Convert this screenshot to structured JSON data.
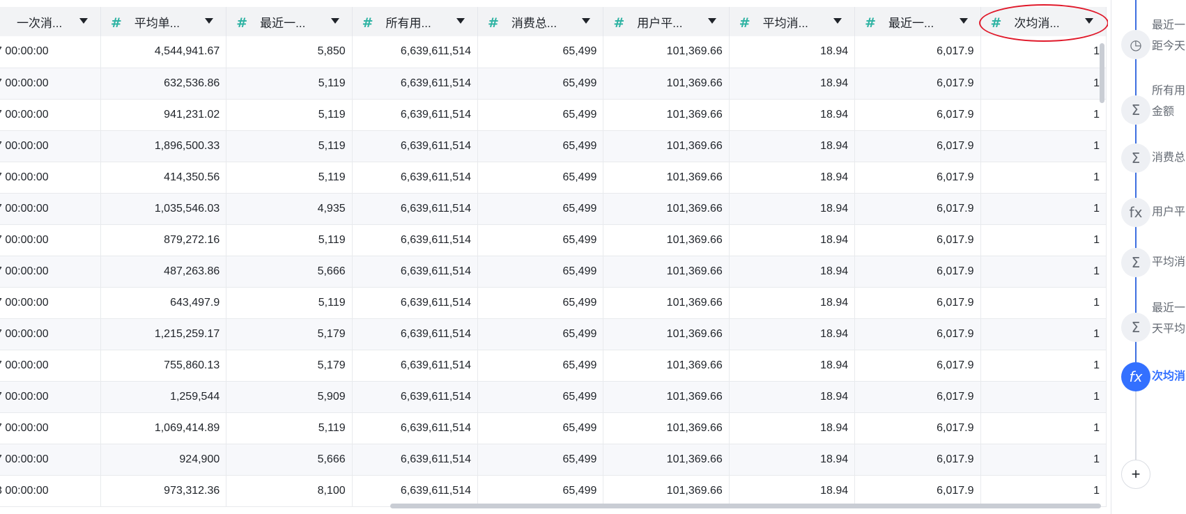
{
  "table": {
    "columns": [
      {
        "label": "一次消...",
        "type_icon": "hash-icon"
      },
      {
        "label": "平均单...",
        "type_icon": "hash-icon"
      },
      {
        "label": "最近一...",
        "type_icon": "hash-icon"
      },
      {
        "label": "所有用...",
        "type_icon": "hash-icon"
      },
      {
        "label": "消费总...",
        "type_icon": "hash-icon"
      },
      {
        "label": "用户平...",
        "type_icon": "hash-icon"
      },
      {
        "label": "平均消...",
        "type_icon": "hash-icon"
      },
      {
        "label": "最近一...",
        "type_icon": "hash-icon"
      },
      {
        "label": "次均消...",
        "type_icon": "hash-icon"
      }
    ],
    "rows": [
      [
        "7 00:00:00",
        "4,544,941.67",
        "5,850",
        "6,639,611,514",
        "65,499",
        "101,369.66",
        "18.94",
        "6,017.9",
        "1"
      ],
      [
        "7 00:00:00",
        "632,536.86",
        "5,119",
        "6,639,611,514",
        "65,499",
        "101,369.66",
        "18.94",
        "6,017.9",
        "1"
      ],
      [
        "7 00:00:00",
        "941,231.02",
        "5,119",
        "6,639,611,514",
        "65,499",
        "101,369.66",
        "18.94",
        "6,017.9",
        "1"
      ],
      [
        "7 00:00:00",
        "1,896,500.33",
        "5,119",
        "6,639,611,514",
        "65,499",
        "101,369.66",
        "18.94",
        "6,017.9",
        "1"
      ],
      [
        "7 00:00:00",
        "414,350.56",
        "5,119",
        "6,639,611,514",
        "65,499",
        "101,369.66",
        "18.94",
        "6,017.9",
        "1"
      ],
      [
        "7 00:00:00",
        "1,035,546.03",
        "4,935",
        "6,639,611,514",
        "65,499",
        "101,369.66",
        "18.94",
        "6,017.9",
        "1"
      ],
      [
        "7 00:00:00",
        "879,272.16",
        "5,119",
        "6,639,611,514",
        "65,499",
        "101,369.66",
        "18.94",
        "6,017.9",
        "1"
      ],
      [
        "7 00:00:00",
        "487,263.86",
        "5,666",
        "6,639,611,514",
        "65,499",
        "101,369.66",
        "18.94",
        "6,017.9",
        "1"
      ],
      [
        "7 00:00:00",
        "643,497.9",
        "5,119",
        "6,639,611,514",
        "65,499",
        "101,369.66",
        "18.94",
        "6,017.9",
        "1"
      ],
      [
        "7 00:00:00",
        "1,215,259.17",
        "5,179",
        "6,639,611,514",
        "65,499",
        "101,369.66",
        "18.94",
        "6,017.9",
        "1"
      ],
      [
        "7 00:00:00",
        "755,860.13",
        "5,179",
        "6,639,611,514",
        "65,499",
        "101,369.66",
        "18.94",
        "6,017.9",
        "1"
      ],
      [
        "7 00:00:00",
        "1,259,544",
        "5,909",
        "6,639,611,514",
        "65,499",
        "101,369.66",
        "18.94",
        "6,017.9",
        "1"
      ],
      [
        "7 00:00:00",
        "1,069,414.89",
        "5,119",
        "6,639,611,514",
        "65,499",
        "101,369.66",
        "18.94",
        "6,017.9",
        "1"
      ],
      [
        "7 00:00:00",
        "924,900",
        "5,666",
        "6,639,611,514",
        "65,499",
        "101,369.66",
        "18.94",
        "6,017.9",
        "1"
      ],
      [
        "3 00:00:00",
        "973,312.36",
        "8,100",
        "6,639,611,514",
        "65,499",
        "101,369.66",
        "18.94",
        "6,017.9",
        "1"
      ]
    ]
  },
  "steps_panel": {
    "steps": [
      {
        "icon": "clock-icon",
        "glyph": "◷",
        "lines": [
          "最近一",
          "距今天"
        ],
        "active": false
      },
      {
        "icon": "sum-icon",
        "glyph": "Σ",
        "lines": [
          "所有用",
          "金额"
        ],
        "active": false
      },
      {
        "icon": "sum-icon",
        "glyph": "Σ",
        "lines": [
          "消费总"
        ],
        "active": false
      },
      {
        "icon": "formula-icon",
        "glyph": "fx",
        "lines": [
          "用户平"
        ],
        "active": false
      },
      {
        "icon": "sum-icon",
        "glyph": "Σ",
        "lines": [
          "平均消"
        ],
        "active": false
      },
      {
        "icon": "sum-icon",
        "glyph": "Σ",
        "lines": [
          "最近一",
          "天平均"
        ],
        "active": false
      },
      {
        "icon": "formula-icon",
        "glyph": "fx",
        "lines": [
          "次均消"
        ],
        "active": true
      }
    ],
    "add_label": "+"
  },
  "colors": {
    "accent": "#3370ff",
    "highlight_ring": "#e0192a",
    "type_icon": "#2fb3a3"
  }
}
